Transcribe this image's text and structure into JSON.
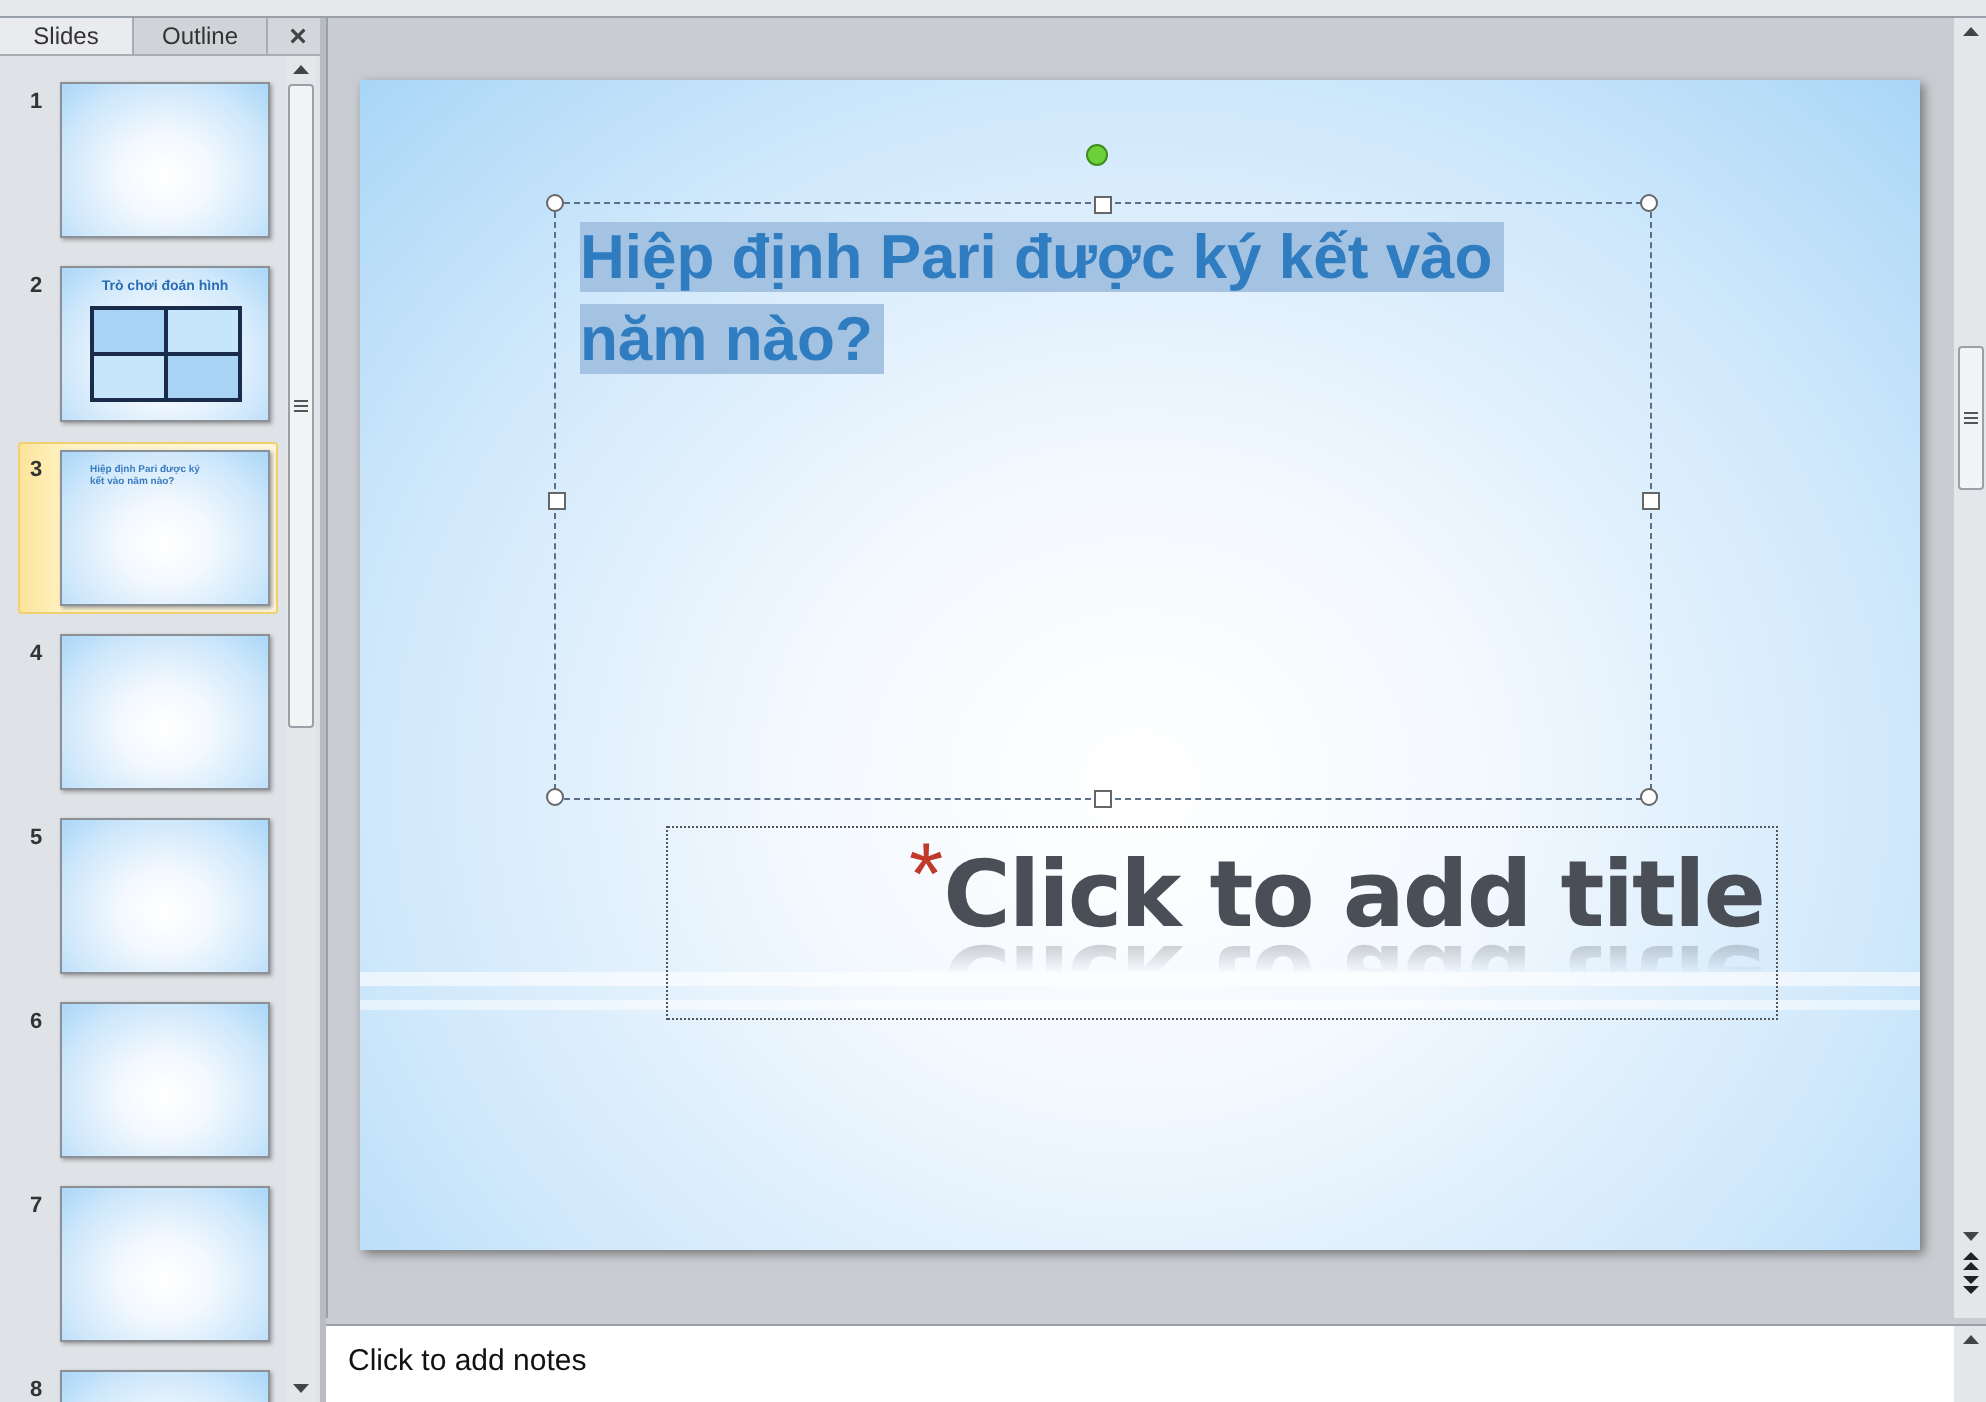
{
  "panel_tabs": [
    {
      "label": "Slides",
      "selected": true
    },
    {
      "label": "Outline",
      "selected": false
    }
  ],
  "panel_close": "×",
  "slides": [
    {
      "number": "1",
      "selected": false
    },
    {
      "number": "2",
      "selected": false,
      "title": "Trò chơi đoán hình",
      "table": true
    },
    {
      "number": "3",
      "selected": true,
      "title": "Hiệp định Pari được ký kết vào năm nào?"
    },
    {
      "number": "4",
      "selected": false
    },
    {
      "number": "5",
      "selected": false
    },
    {
      "number": "6",
      "selected": false
    },
    {
      "number": "7",
      "selected": false
    },
    {
      "number": "8",
      "selected": false
    }
  ],
  "slide": {
    "text_box": "Hiệp định Pari được ký kết vào năm nào?",
    "text_selected": true,
    "title_placeholder": "Click to add title",
    "animation_mark": "*"
  },
  "notes": {
    "placeholder": "Click to add notes"
  }
}
